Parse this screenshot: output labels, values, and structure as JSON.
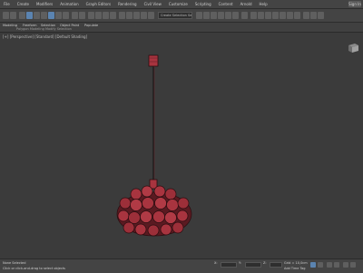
{
  "menubar": {
    "items": [
      "File",
      "Create",
      "Modifiers",
      "Animation",
      "Graph Editors",
      "Rendering",
      "Civil View",
      "Customize",
      "Scripting",
      "Content",
      "Arnold",
      "Help"
    ],
    "sign_in": "Sign In"
  },
  "toolbar": {
    "selection_set": "Create Selection Set"
  },
  "ribbon": {
    "tabs": [
      "Modeling",
      "Freeform",
      "Selection",
      "Object Paint",
      "Populate"
    ],
    "sub_labels": [
      "Polygon Modeling",
      "Modify Selection"
    ]
  },
  "viewport": {
    "label": "[+] [Perspective] [Standard] [Default Shading]",
    "viewcube_icon": "viewcube-icon"
  },
  "status": {
    "left_text": "None Selected",
    "prompt_text": "Click or click-and-drag to select objects",
    "grid_text": "Grid = 10,0cm",
    "time_tag": "Add Time Tag",
    "coord_x_label": "X:",
    "coord_y_label": "Y:",
    "coord_z_label": "Z:",
    "auto_key": "Auto Key",
    "set_key": "Set Key"
  },
  "colors": {
    "lamp_shade": "#a8343f",
    "lamp_dark": "#6a1f27",
    "lamp_outline": "#2a0d10",
    "cord": "#1e1e1e",
    "accent": "#5b84b1"
  }
}
